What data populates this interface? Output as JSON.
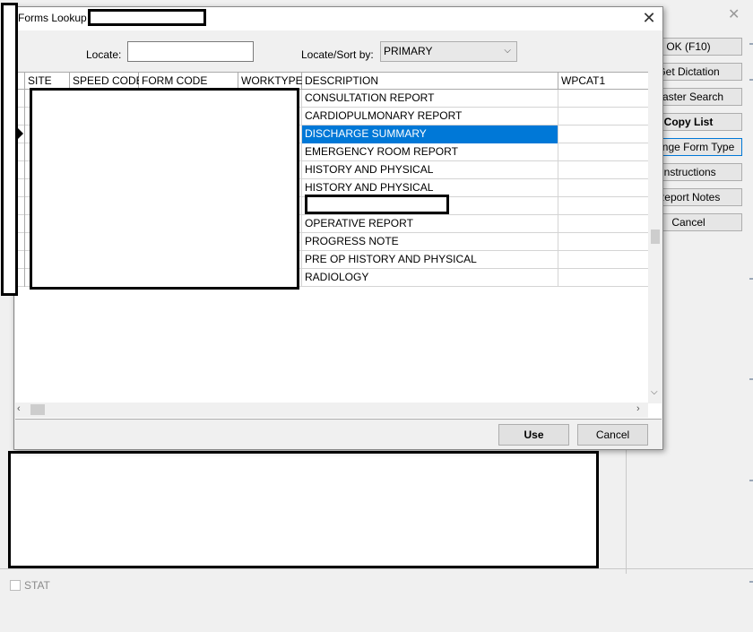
{
  "background": {
    "side_buttons": [
      {
        "label": "OK  (F10)",
        "name": "ok-button"
      },
      {
        "label": "Get Dictation",
        "name": "get-dictation-button"
      },
      {
        "label": "Master Search",
        "name": "master-search-button"
      },
      {
        "label": "Copy List",
        "name": "copy-list-button"
      },
      {
        "label": "Change Form Type",
        "name": "change-form-type-button"
      },
      {
        "label": "Instructions",
        "name": "instructions-button"
      },
      {
        "label": "Report Notes",
        "name": "report-notes-button"
      },
      {
        "label": "Cancel",
        "name": "cancel-side-button"
      }
    ],
    "stat_label": "STAT"
  },
  "dialog": {
    "title": "Forms Lookup",
    "locate_label": "Locate:",
    "locate_value": "",
    "sort_label": "Locate/Sort by:",
    "sort_value": "PRIMARY",
    "columns": [
      "SITE",
      "SPEED CODE",
      "FORM CODE",
      "WORKTYPE",
      "DESCRIPTION",
      "WPCAT1"
    ],
    "rows": [
      "CONSULTATION REPORT",
      "CARDIOPULMONARY REPORT",
      "DISCHARGE SUMMARY",
      "EMERGENCY ROOM REPORT",
      "HISTORY AND PHYSICAL",
      "HISTORY AND PHYSICAL",
      "",
      "OPERATIVE REPORT",
      "PROGRESS NOTE",
      "PRE OP HISTORY AND PHYSICAL",
      "RADIOLOGY"
    ],
    "selected_row": 2,
    "use_label": "Use",
    "cancel_label": "Cancel"
  }
}
